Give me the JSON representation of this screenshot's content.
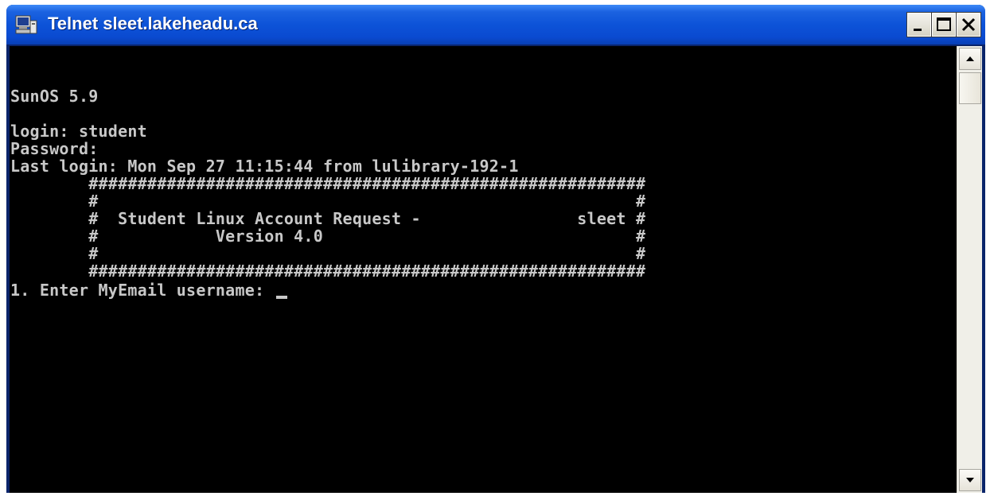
{
  "window": {
    "title": "Telnet sleet.lakeheadu.ca",
    "icon": "telnet-computer-icon"
  },
  "title_buttons": {
    "minimize_icon": "minimize-icon",
    "maximize_icon": "maximize-icon",
    "close_icon": "close-icon"
  },
  "terminal": {
    "lines": [
      "",
      "",
      "SunOS 5.9",
      "",
      "login: student",
      "Password:",
      "Last login: Mon Sep 27 11:15:44 from lulibrary-192-1",
      "        #########################################################",
      "        #                                                       #",
      "        #  Student Linux Account Request -                sleet #",
      "        #            Version 4.0                                #",
      "        #                                                       #",
      "        #########################################################",
      "1. Enter MyEmail username: "
    ],
    "cursor": "_"
  },
  "scrollbar": {
    "up_icon": "scroll-up-arrow-icon",
    "down_icon": "scroll-down-arrow-icon"
  }
}
